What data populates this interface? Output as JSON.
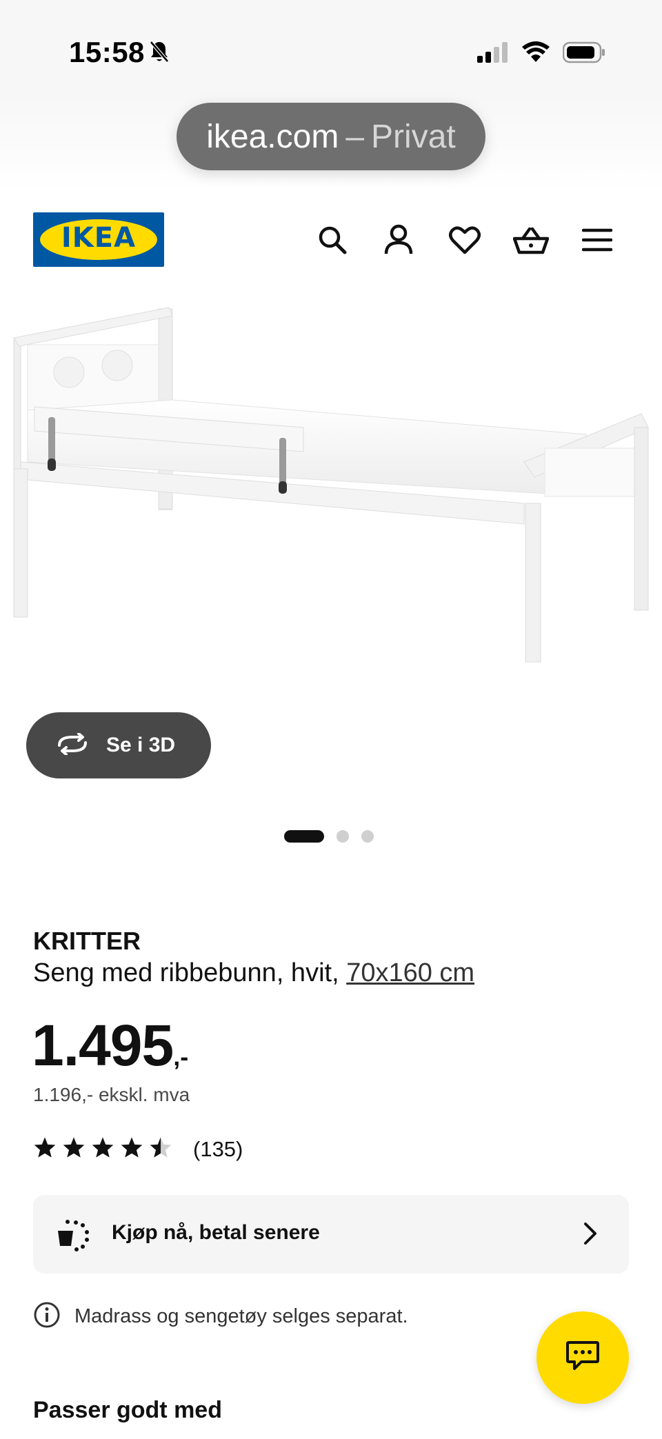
{
  "status_bar": {
    "time": "15:58",
    "icons": [
      "bell-slash-icon",
      "cellular-signal-icon",
      "wifi-icon",
      "battery-icon"
    ]
  },
  "browser": {
    "url_domain": "ikea.com",
    "url_separator": "–",
    "url_mode": "Privat"
  },
  "header": {
    "logo_text": "IKEA",
    "icons": [
      "search-icon",
      "account-icon",
      "heart-icon",
      "basket-icon",
      "menu-icon"
    ]
  },
  "gallery": {
    "view_3d_label": "Se i 3D",
    "slide_count": 3,
    "active_slide": 1
  },
  "product": {
    "brand": "KRITTER",
    "description": "Seng med ribbebunn, hvit,",
    "size": "70x160 cm",
    "price_main": "1.495",
    "price_suffix": ",-",
    "price_ex_vat": "1.196,- ekskl. mva",
    "rating": 4.5,
    "rating_count": "(135)"
  },
  "pay_later": {
    "label": "Kjøp nå, betal senere"
  },
  "notice": {
    "text": "Madrass og sengetøy selges separat."
  },
  "sections": {
    "related_title": "Passer godt med"
  },
  "colors": {
    "ikea_blue": "#0058a3",
    "ikea_yellow": "#ffdb00",
    "dark_button": "#484848",
    "panel_bg": "#f5f5f5"
  }
}
